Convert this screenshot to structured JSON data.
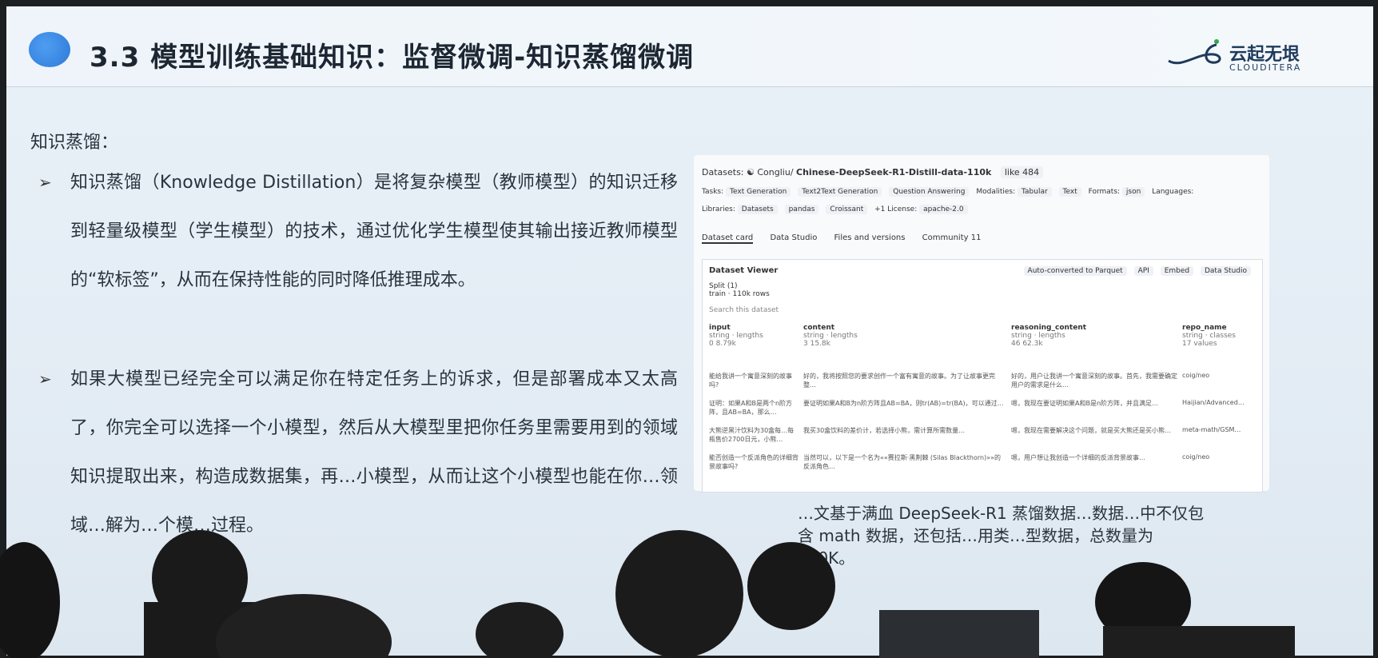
{
  "slide": {
    "title": "3.3 模型训练基础知识：监督微调-知识蒸馏微调",
    "logo_cn": "云起无垠",
    "logo_en": "CLOUDITERA",
    "section_heading": "知识蒸馏：",
    "bullets": [
      {
        "arrow": "➢",
        "text": "知识蒸馏（Knowledge Distillation）是将复杂模型（教师模型）的知识迁移到轻量级模型（学生模型）的技术，通过优化学生模型使其输出接近教师模型的“软标签”，从而在保持性能的同时降低推理成本。"
      },
      {
        "arrow": "➢",
        "text": "如果大模型已经完全可以满足你在特定任务上的诉求，但是部署成本又太高了，你完全可以选择一个小模型，然后从大模型里把你任务里需要用到的领域知识提取出来，构造成数据集，再…小模型，从而让这个小模型也能在你…领域…解为…个模…过程。"
      }
    ],
    "caption": "…文基于满血 DeepSeek-R1 蒸馏数据…数据…中不仅包含 math 数据，还包括…用类…型数据，总数量为 110K。"
  },
  "dataset_page": {
    "breadcrumb": "Datasets: ☯ Congliu/",
    "name": "Chinese-DeepSeek-R1-Distill-data-110k",
    "likes": "like 484",
    "tasks_label": "Tasks:",
    "tasks": [
      "Text Generation",
      "Text2Text Generation",
      "Question Answering"
    ],
    "modalities_label": "Modalities:",
    "modalities": [
      "Tabular",
      "Text"
    ],
    "formats_label": "Formats:",
    "format": "json",
    "languages_label": "Languages:",
    "libraries_label": "Libraries:",
    "libraries": [
      "Datasets",
      "pandas",
      "Croissant",
      "+1"
    ],
    "license_label": "License:",
    "license": "apache-2.0",
    "tabs": [
      "Dataset card",
      "Data Studio",
      "Files and versions",
      "Community 11"
    ],
    "viewer_title": "Dataset Viewer",
    "viewer_actions": [
      "Auto-converted to Parquet",
      "API",
      "Embed",
      "Data Studio"
    ],
    "split_label": "Split (1)",
    "split_value": "train · 110k rows",
    "search_placeholder": "Search this dataset",
    "columns": [
      {
        "name": "input",
        "type": "string · lengths",
        "range": "0   8.79k"
      },
      {
        "name": "content",
        "type": "string · lengths",
        "range": "3   15.8k"
      },
      {
        "name": "reasoning_content",
        "type": "string · lengths",
        "range": "46   62.3k"
      },
      {
        "name": "repo_name",
        "type": "string · classes",
        "range": "17 values"
      }
    ],
    "rows": [
      [
        "能给我讲一个寓意深刻的故事吗?",
        "好的，我将按照您的要求创作一个富有寓意的故事。为了让故事更完整…",
        "好的，用户让我讲一个寓意深刻的故事。首先，我需要确定用户的需求是什么…",
        "coig/neo"
      ],
      [
        "证明：如果A和B是两个n阶方阵，且AB=BA，那么…",
        "要证明如果A和B为n阶方阵且AB=BA，则tr(AB)=tr(BA)，可以通过…",
        "嗯，我现在要证明如果A和B是n阶方阵，并且满足…",
        "Haijian/Advanced…"
      ],
      [
        "大熊逆黑汁饮料为30盒每…每瓶售价2700日元，小熊…",
        "我买30盒饮料的差价计，若选择小熊，需计算所需数量…",
        "嗯，我现在需要解决这个问题，就是买大熊还是买小熊…",
        "meta-math/GSM…"
      ],
      [
        "能否创造一个反派角色的详细背景故事吗?",
        "当然可以，以下是一个名为««赛拉斯·黑荆棘 (Silas Blackthorn)»»的反派角色…",
        "嗯，用户想让我创造一个详细的反派背景故事…",
        "coig/neo"
      ]
    ]
  }
}
